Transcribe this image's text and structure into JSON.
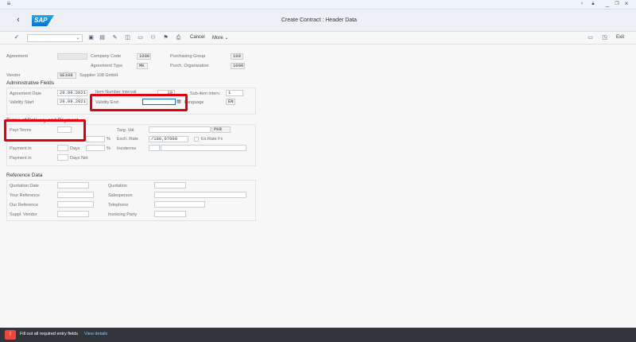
{
  "topbar": {
    "menu_icon": "hamburger-icon",
    "window_controls": [
      "back-icon",
      "lock-icon",
      "minimize-icon",
      "restore-icon",
      "close-icon"
    ]
  },
  "header": {
    "logo": "SAP",
    "title": "Create Contract : Header Data"
  },
  "toolbar": {
    "cancel_label": "Cancel",
    "more_label": "More",
    "exit_label": "Exit"
  },
  "top_fields": {
    "agreement_label": "Agreement",
    "agreement_value": "",
    "company_code_label": "Company Code",
    "company_code_value": "1000",
    "purchasing_group_label": "Purchasing Group",
    "purchasing_group_value": "100",
    "agreement_type_label": "Agreement Type",
    "agreement_type_value": "MK",
    "purch_org_label": "Purch. Organization",
    "purch_org_value": "1000",
    "vendor_label": "Vendor",
    "vendor_value": "SE108",
    "vendor_name": "Supplier 108 GmbH"
  },
  "admin": {
    "title": "Administrative Fields",
    "agreement_date_label": "Agreement Date",
    "agreement_date_value": "29.09.2021",
    "item_interval_label": "Item Number Interval",
    "item_interval_value": "10",
    "subitem_label": "Sub-item interv.",
    "subitem_value": "1",
    "validity_start_label": "Validity Start",
    "validity_start_value": "29.09.2021",
    "validity_end_label": "Validity End",
    "validity_end_value": "",
    "language_label": "Language",
    "language_value": "EN"
  },
  "terms": {
    "title": "Terms of Delivery and Payment",
    "payt_terms_label": "Payt Terms",
    "payt_terms_value": "",
    "targ_val_label": "Targ. Val.",
    "targ_val_value": "",
    "currency": "PKR",
    "percent_symbol": "%",
    "exch_rate_label": "Exch. Rate",
    "exch_rate_value": "/180,07600",
    "exrate_fx_label": "Ex.Rate Fx",
    "payment_in_label": "Payment in",
    "days_label": "Days",
    "incoterms_label": "Incoterms",
    "payment_in2_label": "Payment in",
    "days_net_label": "Days Net"
  },
  "reference": {
    "title": "Reference Data",
    "quotation_date_label": "Quotation Date",
    "quotation_label": "Quotation",
    "your_reference_label": "Your Reference",
    "salesperson_label": "Salesperson",
    "our_reference_label": "Our Reference",
    "telephone_label": "Telephone",
    "suppl_vendor_label": "Suppl. Vendor",
    "invoicing_party_label": "Invoicing Party"
  },
  "status": {
    "message": "Fill out all required entry fields",
    "link": "View details"
  },
  "colors": {
    "accent": "#0a6ed1",
    "highlight": "#e0000f",
    "status_bg": "#32363a",
    "error": "#e9473f"
  }
}
